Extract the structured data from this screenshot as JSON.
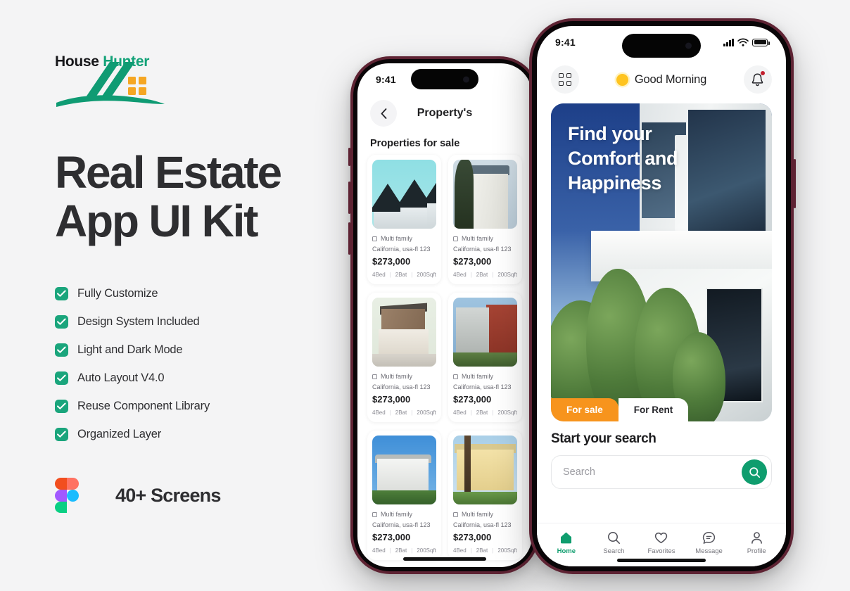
{
  "brand": {
    "name_first": "House",
    "name_second": "Hunter",
    "accent_color": "#13a278"
  },
  "headline": {
    "line1": "Real Estate",
    "line2": "App UI Kit"
  },
  "features": [
    {
      "label": "Fully Customize"
    },
    {
      "label": "Design System Included"
    },
    {
      "label": "Light and Dark Mode"
    },
    {
      "label": "Auto Layout V4.0"
    },
    {
      "label": "Reuse Component Library"
    },
    {
      "label": "Organized Layer"
    }
  ],
  "screens_badge": {
    "label": "40+ Screens",
    "tool_icon": "figma-icon"
  },
  "phone_right": {
    "status_bar": {
      "time": "9:41",
      "signal_icon": "cellular-signal-icon",
      "wifi_icon": "wifi-icon",
      "battery_icon": "battery-icon"
    },
    "header": {
      "grid_icon": "grid-menu-icon",
      "sun_icon": "sun-icon",
      "greeting": "Good Morning",
      "bell_icon": "notification-bell-icon"
    },
    "hero": {
      "title_line1": "Find your",
      "title_line2": "Comfort and",
      "title_line3": "Happiness"
    },
    "tabs": [
      {
        "label": "For sale",
        "active": true
      },
      {
        "label": "For Rent",
        "active": false
      }
    ],
    "search": {
      "title": "Start your search",
      "placeholder": "Search",
      "button_icon": "search-icon",
      "button_color": "#0f9d6e"
    },
    "bottom_nav": [
      {
        "label": "Home",
        "icon": "home-icon",
        "active": true
      },
      {
        "label": "Search",
        "icon": "search-icon",
        "active": false
      },
      {
        "label": "Favorites",
        "icon": "heart-icon",
        "active": false
      },
      {
        "label": "Message",
        "icon": "message-icon",
        "active": false
      },
      {
        "label": "Profile",
        "icon": "person-icon",
        "active": false
      }
    ]
  },
  "phone_left": {
    "status_bar": {
      "time": "9:41"
    },
    "header": {
      "back_icon": "chevron-left-icon",
      "title": "Property's"
    },
    "section_title": "Properties for sale",
    "cards": [
      {
        "type": "Multi family",
        "address": "California, usa-fl 123",
        "price": "$273,000",
        "beds": "4Bed",
        "baths": "2Bat",
        "area": "200Sqft",
        "photo": "gable-houses"
      },
      {
        "type": "Multi family",
        "address": "California, usa-fl 123",
        "price": "$273,000",
        "beds": "4Bed",
        "baths": "2Bat",
        "area": "200Sqft",
        "photo": "white-villa"
      },
      {
        "type": "Multi family",
        "address": "California, usa-fl 123",
        "price": "$273,000",
        "beds": "4Bed",
        "baths": "2Bat",
        "area": "200Sqft",
        "photo": "modern-two-storey"
      },
      {
        "type": "Multi family",
        "address": "California, usa-fl 123",
        "price": "$273,000",
        "beds": "4Bed",
        "baths": "2Bat",
        "area": "200Sqft",
        "photo": "red-apartment"
      },
      {
        "type": "Multi family",
        "address": "California, usa-fl 123",
        "price": "$273,000",
        "beds": "4Bed",
        "baths": "2Bat",
        "area": "200Sqft",
        "photo": "white-bungalow"
      },
      {
        "type": "Multi family",
        "address": "California, usa-fl 123",
        "price": "$273,000",
        "beds": "4Bed",
        "baths": "2Bat",
        "area": "200Sqft",
        "photo": "yellow-house"
      }
    ],
    "separator": "|"
  }
}
